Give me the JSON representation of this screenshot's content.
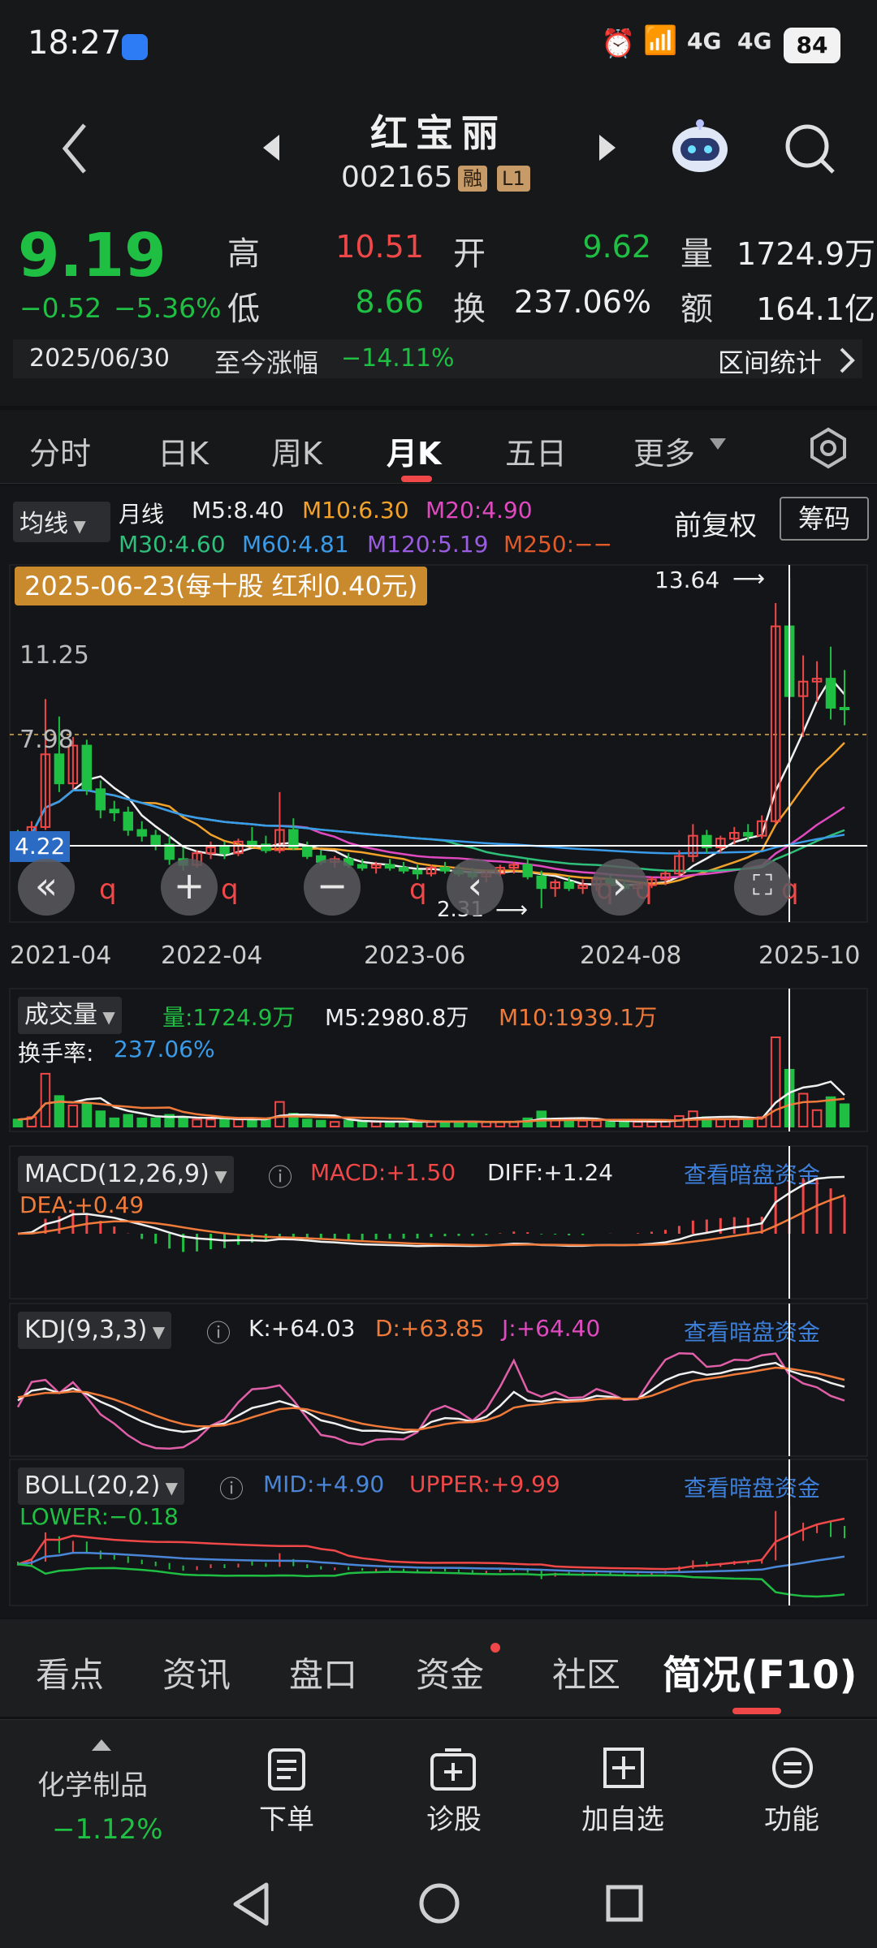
{
  "status_bar": {
    "time": "18:27",
    "battery": "84",
    "net1": "4G",
    "net2": "4G"
  },
  "header": {
    "name": "红宝丽",
    "code": "002165",
    "badge_rong": "融",
    "badge_level": "L1"
  },
  "quote": {
    "price": "9.19",
    "change": "−0.52",
    "change_pct": "−5.36%",
    "high_label": "高",
    "high": "10.51",
    "low_label": "低",
    "low": "8.66",
    "open_label": "开",
    "open": "9.62",
    "turnover_label": "换",
    "turnover": "237.06%",
    "vol_label": "量",
    "vol": "1724.9万",
    "amt_label": "额",
    "amt": "164.1亿",
    "date": "2025/06/30",
    "since_label": "至今涨幅",
    "since_value": "−14.11%",
    "range_stats": "区间统计"
  },
  "tabs": [
    "分时",
    "日K",
    "周K",
    "月K",
    "五日",
    "更多"
  ],
  "ma_bar": {
    "select": "均线",
    "period": "月线",
    "m5": "M5:8.40",
    "m10": "M10:6.30",
    "m20": "M20:4.90",
    "m30": "M30:4.60",
    "m60": "M60:4.81",
    "m120": "M120:5.19",
    "m250": "M250:−−",
    "adjust": "前复权",
    "chips": "筹码"
  },
  "kline": {
    "dividend_tag": "2025-06-23(每十股 红利0.40元)",
    "max_label": "13.64",
    "min_label": "2.31",
    "cursor_price": "4.22",
    "y_labels": [
      "11.25",
      "7.98"
    ],
    "x_labels": [
      "2021-04",
      "2022-04",
      "2023-06",
      "2024-08",
      "2025-10"
    ],
    "q_marker": "q"
  },
  "chart_data": {
    "type": "candlestick",
    "period": "monthly",
    "x_start": "2021-04",
    "ohlc": [
      [
        4.8,
        5.0,
        4.4,
        4.6
      ],
      [
        4.6,
        5.3,
        4.5,
        5.1
      ],
      [
        5.1,
        9.5,
        5.0,
        7.6
      ],
      [
        7.6,
        8.9,
        6.3,
        6.6
      ],
      [
        6.6,
        8.2,
        6.4,
        7.9
      ],
      [
        7.9,
        8.1,
        6.2,
        6.4
      ],
      [
        6.4,
        6.7,
        5.4,
        5.7
      ],
      [
        5.7,
        6.0,
        5.3,
        5.6
      ],
      [
        5.6,
        5.8,
        4.8,
        5.0
      ],
      [
        5.0,
        5.3,
        4.6,
        4.8
      ],
      [
        4.8,
        5.0,
        4.3,
        4.5
      ],
      [
        4.5,
        4.8,
        3.8,
        4.0
      ],
      [
        4.0,
        4.4,
        3.6,
        3.8
      ],
      [
        3.8,
        4.3,
        3.7,
        4.2
      ],
      [
        4.2,
        4.6,
        4.0,
        4.4
      ],
      [
        4.4,
        4.6,
        4.0,
        4.2
      ],
      [
        4.2,
        4.7,
        4.1,
        4.6
      ],
      [
        4.6,
        5.1,
        4.4,
        4.5
      ],
      [
        4.5,
        4.8,
        4.2,
        4.3
      ],
      [
        4.3,
        6.3,
        4.2,
        5.0
      ],
      [
        5.0,
        5.4,
        4.3,
        4.4
      ],
      [
        4.4,
        4.6,
        4.0,
        4.1
      ],
      [
        4.1,
        4.3,
        3.8,
        3.9
      ],
      [
        3.9,
        4.1,
        3.7,
        4.0
      ],
      [
        4.0,
        4.2,
        3.7,
        3.8
      ],
      [
        3.8,
        4.0,
        3.6,
        3.7
      ],
      [
        3.7,
        3.9,
        3.5,
        3.8
      ],
      [
        3.8,
        4.0,
        3.6,
        3.7
      ],
      [
        3.7,
        3.9,
        3.5,
        3.6
      ],
      [
        3.6,
        3.8,
        3.3,
        3.5
      ],
      [
        3.5,
        3.8,
        3.4,
        3.7
      ],
      [
        3.7,
        3.9,
        3.5,
        3.6
      ],
      [
        3.6,
        3.8,
        3.4,
        3.5
      ],
      [
        3.5,
        3.7,
        3.3,
        3.4
      ],
      [
        3.4,
        3.6,
        3.2,
        3.5
      ],
      [
        3.5,
        3.8,
        3.4,
        3.7
      ],
      [
        3.7,
        3.9,
        3.5,
        3.8
      ],
      [
        3.8,
        4.0,
        3.3,
        3.4
      ],
      [
        3.4,
        3.6,
        2.31,
        3.0
      ],
      [
        3.0,
        3.3,
        2.7,
        3.2
      ],
      [
        3.2,
        3.4,
        2.9,
        3.0
      ],
      [
        3.0,
        3.3,
        2.8,
        3.1
      ],
      [
        3.1,
        3.4,
        2.9,
        3.3
      ],
      [
        3.3,
        3.5,
        3.0,
        3.1
      ],
      [
        3.1,
        3.3,
        2.9,
        3.0
      ],
      [
        3.0,
        3.2,
        2.8,
        3.1
      ],
      [
        3.1,
        3.4,
        3.0,
        3.3
      ],
      [
        3.3,
        3.6,
        3.1,
        3.5
      ],
      [
        3.5,
        4.3,
        3.4,
        4.1
      ],
      [
        4.1,
        5.2,
        3.9,
        4.8
      ],
      [
        4.8,
        5.0,
        4.2,
        4.4
      ],
      [
        4.4,
        4.8,
        4.2,
        4.7
      ],
      [
        4.7,
        5.1,
        4.5,
        4.9
      ],
      [
        4.9,
        5.2,
        4.6,
        4.8
      ],
      [
        4.8,
        5.5,
        4.7,
        5.3
      ],
      [
        5.3,
        12.8,
        5.2,
        12.0
      ],
      [
        12.0,
        13.64,
        8.8,
        9.6
      ],
      [
        9.6,
        11.0,
        8.2,
        10.1
      ],
      [
        10.1,
        10.8,
        9.4,
        10.2
      ],
      [
        10.2,
        11.3,
        8.8,
        9.2
      ],
      [
        9.2,
        10.5,
        8.6,
        9.19
      ]
    ],
    "y_range": [
      2.0,
      14.0
    ]
  },
  "volume": {
    "select": "成交量",
    "vol": "量:1724.9万",
    "m5": "M5:2980.8万",
    "m10": "M10:1939.1万",
    "turnover_label": "换手率:",
    "turnover": "237.06%"
  },
  "macd": {
    "select": "MACD(12,26,9)",
    "macd": "MACD:+1.50",
    "diff": "DIFF:+1.24",
    "dea": "DEA:+0.49",
    "link": "查看暗盘资金"
  },
  "kdj": {
    "select": "KDJ(9,3,3)",
    "k": "K:+64.03",
    "d": "D:+63.85",
    "j": "J:+64.40",
    "link": "查看暗盘资金"
  },
  "boll": {
    "select": "BOLL(20,2)",
    "mid": "MID:+4.90",
    "upper": "UPPER:+9.99",
    "lower": "LOWER:−0.18",
    "link": "查看暗盘资金"
  },
  "bottom_tabs": [
    "看点",
    "资讯",
    "盘口",
    "资金",
    "社区",
    "简况(F10)"
  ],
  "dock": {
    "sector": "化学制品",
    "sector_chg": "−1.12%",
    "order": "下单",
    "diagnose": "诊股",
    "add_watch": "加自选",
    "function": "功能"
  },
  "colors": {
    "up": "#f04848",
    "down": "#1fbf44",
    "link": "#3d7fd8",
    "ma10": "#f2a22b",
    "ma20": "#e04ac0",
    "ma30": "#2fbf7a",
    "ma60": "#3a9be8",
    "ma120": "#9a5ce0",
    "ma250": "#e05a2a"
  }
}
